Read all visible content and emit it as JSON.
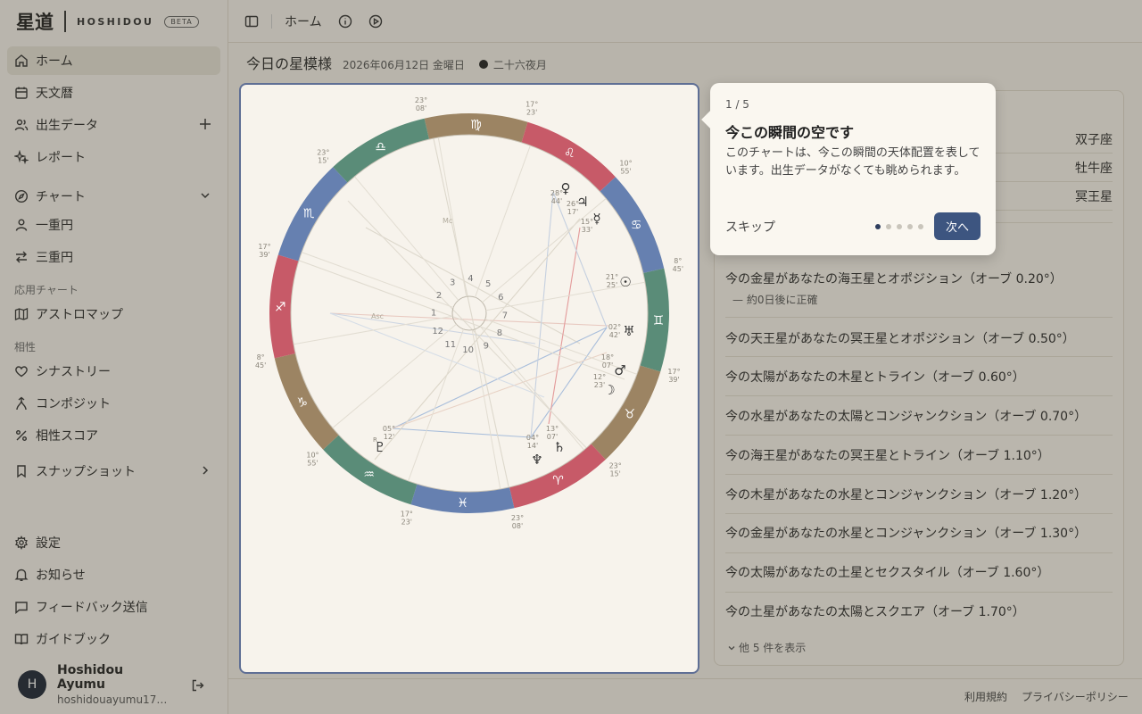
{
  "brand": {
    "kanji": "星道",
    "name": "HOSHIDOU",
    "beta": "BETA"
  },
  "sidebar": {
    "items": [
      {
        "label": "ホーム",
        "icon": "home-icon"
      },
      {
        "label": "天文暦",
        "icon": "calendar-icon"
      },
      {
        "label": "出生データ",
        "icon": "users-icon"
      },
      {
        "label": "レポート",
        "icon": "sparkles-icon"
      },
      {
        "label": "チャート",
        "icon": "compass-icon"
      },
      {
        "label": "一重円",
        "icon": "user-icon"
      },
      {
        "label": "三重円",
        "icon": "arrows-icon"
      },
      {
        "label": "アストロマップ",
        "icon": "map-icon"
      },
      {
        "label": "シナストリー",
        "icon": "heart-icon"
      },
      {
        "label": "コンポジット",
        "icon": "merge-icon"
      },
      {
        "label": "相性スコア",
        "icon": "percent-icon"
      },
      {
        "label": "スナップショット",
        "icon": "bookmark-icon"
      },
      {
        "label": "設定",
        "icon": "gear-icon"
      },
      {
        "label": "お知らせ",
        "icon": "bell-icon"
      },
      {
        "label": "フィードバック送信",
        "icon": "message-icon"
      },
      {
        "label": "ガイドブック",
        "icon": "book-icon"
      }
    ],
    "section_applied": "応用チャート",
    "section_compat": "相性"
  },
  "user": {
    "initial": "H",
    "name": "Hoshidou Ayumu",
    "email": "hoshidouayumu1781..."
  },
  "topbar": {
    "title": "ホーム"
  },
  "page": {
    "title": "今日の星模様",
    "date": "2026年06月12日 金曜日",
    "moon": "二十六夜月"
  },
  "signs": [
    {
      "value": "双子座"
    },
    {
      "value": "牡牛座"
    },
    {
      "value": "冥王星"
    }
  ],
  "aspects": [
    {
      "text": "今の金星があなたの海王星とオポジション（オーブ 0.20°）",
      "sub": "— 約0日後に正確"
    },
    {
      "text": "今の天王星があなたの冥王星とオポジション（オーブ 0.50°）"
    },
    {
      "text": "今の太陽があなたの木星とトライン（オーブ 0.60°）"
    },
    {
      "text": "今の水星があなたの太陽とコンジャンクション（オーブ 0.70°）"
    },
    {
      "text": "今の海王星があなたの冥王星とトライン（オーブ 1.10°）"
    },
    {
      "text": "今の木星があなたの水星とコンジャンクション（オーブ 1.20°）"
    },
    {
      "text": "今の金星があなたの水星とコンジャンクション（オーブ 1.30°）"
    },
    {
      "text": "今の太陽があなたの土星とセクスタイル（オーブ 1.60°）"
    },
    {
      "text": "今の土星があなたの太陽とスクエア（オーブ 1.70°）"
    }
  ],
  "show_more": "他 5 件を表示",
  "footer": {
    "terms": "利用規約",
    "privacy": "プライバシーポリシー"
  },
  "tour": {
    "step": "1 / 5",
    "title": "今この瞬間の空です",
    "body": "このチャートは、今この瞬間の天体配置を表しています。出生データがなくても眺められます。",
    "skip": "スキップ",
    "next": "次へ",
    "total_steps": 5,
    "current_step": 1
  },
  "chart": {
    "asc_label": "Asc",
    "mc_label": "Mc",
    "signs": [
      {
        "glyph": "♍",
        "color": "#9c8463"
      },
      {
        "glyph": "♌",
        "color": "#c75a68"
      },
      {
        "glyph": "♋",
        "color": "#6680b0"
      },
      {
        "glyph": "♊",
        "color": "#5a8c78"
      },
      {
        "glyph": "♉",
        "color": "#9c8463"
      },
      {
        "glyph": "♈",
        "color": "#c75a68"
      },
      {
        "glyph": "♓",
        "color": "#6680b0"
      },
      {
        "glyph": "♒",
        "color": "#5a8c78"
      },
      {
        "glyph": "♑",
        "color": "#9c8463"
      },
      {
        "glyph": "♐",
        "color": "#c75a68"
      },
      {
        "glyph": "♏",
        "color": "#6680b0"
      },
      {
        "glyph": "♎",
        "color": "#5a8c78"
      }
    ],
    "cusps": [
      {
        "deg": "23°",
        "min": "08'"
      },
      {
        "deg": "17°",
        "min": "23'"
      },
      {
        "deg": "10°",
        "min": "55'"
      },
      {
        "deg": "8°",
        "min": "45'"
      },
      {
        "deg": "17°",
        "min": "39'"
      },
      {
        "deg": "23°",
        "min": "15'"
      },
      {
        "deg": "23°",
        "min": "08'"
      },
      {
        "deg": "17°",
        "min": "23'"
      },
      {
        "deg": "10°",
        "min": "55'"
      },
      {
        "deg": "8°",
        "min": "45'"
      },
      {
        "deg": "17°",
        "min": "39'"
      },
      {
        "deg": "23°",
        "min": "15'"
      }
    ],
    "houses": [
      "1",
      "2",
      "3",
      "4",
      "5",
      "6",
      "7",
      "8",
      "9",
      "10",
      "11",
      "12"
    ],
    "planets": [
      {
        "glyph": "♀",
        "deg": "28°",
        "min": "44'",
        "name": "venus"
      },
      {
        "glyph": "♃",
        "deg": "26°",
        "min": "17'",
        "name": "jupiter"
      },
      {
        "glyph": "☿",
        "deg": "15°",
        "min": "33'",
        "name": "mercury"
      },
      {
        "glyph": "☉",
        "deg": "21°",
        "min": "25'",
        "name": "sun"
      },
      {
        "glyph": "♅",
        "deg": "02°",
        "min": "42'",
        "name": "uranus"
      },
      {
        "glyph": "♂",
        "deg": "18°",
        "min": "07'",
        "name": "mars"
      },
      {
        "glyph": "☽",
        "deg": "12°",
        "min": "23'",
        "name": "moon"
      },
      {
        "glyph": "♄",
        "deg": "13°",
        "min": "07'",
        "name": "saturn"
      },
      {
        "glyph": "♆",
        "deg": "04°",
        "min": "14'",
        "name": "neptune"
      },
      {
        "glyph": "♇",
        "deg": "05°",
        "min": "12'",
        "name": "pluto",
        "retro": "R"
      }
    ]
  }
}
